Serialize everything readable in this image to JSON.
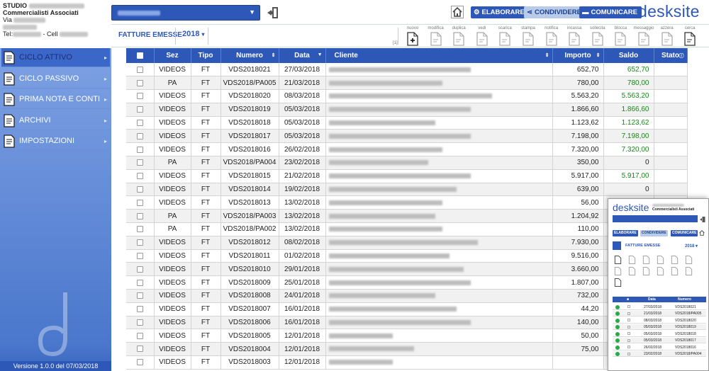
{
  "header": {
    "studio_line1": "STUDIO",
    "studio_line2": "Commercialisti Associati",
    "studio_line3": "Via",
    "studio_line5": "Tel:",
    "studio_cell": "- Cell",
    "company_select_value": "",
    "buttons": {
      "elaborare": "ELABORARE",
      "condividere": "CONDIVIDERE",
      "comunicare": "COMUNICARE"
    },
    "brand": "desksite"
  },
  "toolbar": {
    "title": "FATTURE EMESSE",
    "year": "2018",
    "year_caret": "▾",
    "marker": "[1]",
    "tools": [
      {
        "label": "nuovo",
        "icon": "new-doc-icon",
        "enabled": true
      },
      {
        "label": "modifica",
        "icon": "edit-doc-icon",
        "enabled": false
      },
      {
        "label": "duplica",
        "icon": "duplicate-doc-icon",
        "enabled": false
      },
      {
        "label": "vedi",
        "icon": "view-doc-icon",
        "enabled": false
      },
      {
        "label": "scarica",
        "icon": "download-doc-icon",
        "enabled": false
      },
      {
        "label": "stampa",
        "icon": "print-doc-icon",
        "enabled": false
      },
      {
        "label": "notifica",
        "icon": "notify-doc-icon",
        "enabled": false
      },
      {
        "label": "incassa",
        "icon": "collect-doc-icon",
        "enabled": false
      },
      {
        "label": "sollecita",
        "icon": "remind-doc-icon",
        "enabled": false
      },
      {
        "label": "blocca",
        "icon": "lock-doc-icon",
        "enabled": false
      },
      {
        "label": "messaggio",
        "icon": "message-doc-icon",
        "enabled": false
      },
      {
        "label": "azzera",
        "icon": "reset-doc-icon",
        "enabled": false
      },
      {
        "label": "cerca",
        "icon": "search-doc-icon",
        "enabled": true
      }
    ]
  },
  "sidebar": {
    "items": [
      {
        "label": "CICLO ATTIVO",
        "icon": "invoice-out-icon",
        "active": true
      },
      {
        "label": "CICLO PASSIVO",
        "icon": "invoice-in-icon",
        "active": false
      },
      {
        "label": "PRIMA NOTA E CONTI",
        "icon": "ledger-icon",
        "active": false
      },
      {
        "label": "ARCHIVI",
        "icon": "archive-icon",
        "active": false
      },
      {
        "label": "IMPOSTAZIONI",
        "icon": "settings-doc-icon",
        "active": false
      }
    ],
    "arrow": "▸",
    "footer": "Versione 1.0.0 del 07/03/2018"
  },
  "table": {
    "headers": {
      "sez": "Sez",
      "tipo": "Tipo",
      "numero": "Numero",
      "data": "Data",
      "cliente": "Cliente",
      "importo": "Importo",
      "saldo": "Saldo",
      "stato": "Stato"
    },
    "rows": [
      {
        "sez": "VIDEOS",
        "tipo": "FT",
        "numero": "VDS2018021",
        "data": "27/03/2018",
        "importo": "652,70",
        "saldo": "652,70",
        "green": true
      },
      {
        "sez": "PA",
        "tipo": "FT",
        "numero": "VDS2018/PA005",
        "data": "21/03/2018",
        "importo": "780,00",
        "saldo": "780,00",
        "green": true
      },
      {
        "sez": "VIDEOS",
        "tipo": "FT",
        "numero": "VDS2018020",
        "data": "08/03/2018",
        "importo": "5.563,20",
        "saldo": "5.563,20",
        "green": true
      },
      {
        "sez": "VIDEOS",
        "tipo": "FT",
        "numero": "VDS2018019",
        "data": "05/03/2018",
        "importo": "1.866,60",
        "saldo": "1.866,60",
        "green": true
      },
      {
        "sez": "VIDEOS",
        "tipo": "FT",
        "numero": "VDS2018018",
        "data": "05/03/2018",
        "importo": "1.123,62",
        "saldo": "1.123,62",
        "green": true
      },
      {
        "sez": "VIDEOS",
        "tipo": "FT",
        "numero": "VDS2018017",
        "data": "05/03/2018",
        "importo": "7.198,00",
        "saldo": "7.198,00",
        "green": true
      },
      {
        "sez": "VIDEOS",
        "tipo": "FT",
        "numero": "VDS2018016",
        "data": "26/02/2018",
        "importo": "7.320,00",
        "saldo": "7.320,00",
        "green": true
      },
      {
        "sez": "PA",
        "tipo": "FT",
        "numero": "VDS2018/PA004",
        "data": "23/02/2018",
        "importo": "350,00",
        "saldo": "0",
        "green": false
      },
      {
        "sez": "VIDEOS",
        "tipo": "FT",
        "numero": "VDS2018015",
        "data": "21/02/2018",
        "importo": "5.917,00",
        "saldo": "5.917,00",
        "green": true
      },
      {
        "sez": "VIDEOS",
        "tipo": "FT",
        "numero": "VDS2018014",
        "data": "19/02/2018",
        "importo": "639,00",
        "saldo": "0",
        "green": false
      },
      {
        "sez": "VIDEOS",
        "tipo": "FT",
        "numero": "VDS2018013",
        "data": "13/02/2018",
        "importo": "56,00",
        "saldo": "",
        "green": false
      },
      {
        "sez": "PA",
        "tipo": "FT",
        "numero": "VDS2018/PA003",
        "data": "13/02/2018",
        "importo": "1.204,92",
        "saldo": "",
        "green": false
      },
      {
        "sez": "PA",
        "tipo": "FT",
        "numero": "VDS2018/PA002",
        "data": "13/02/2018",
        "importo": "110,00",
        "saldo": "",
        "green": false
      },
      {
        "sez": "VIDEOS",
        "tipo": "FT",
        "numero": "VDS2018012",
        "data": "08/02/2018",
        "importo": "7.930,00",
        "saldo": "",
        "green": false
      },
      {
        "sez": "VIDEOS",
        "tipo": "FT",
        "numero": "VDS2018011",
        "data": "01/02/2018",
        "importo": "9.516,00",
        "saldo": "",
        "green": false
      },
      {
        "sez": "VIDEOS",
        "tipo": "FT",
        "numero": "VDS2018010",
        "data": "29/01/2018",
        "importo": "3.660,00",
        "saldo": "",
        "green": false
      },
      {
        "sez": "VIDEOS",
        "tipo": "FT",
        "numero": "VDS2018009",
        "data": "25/01/2018",
        "importo": "1.807,00",
        "saldo": "",
        "green": false
      },
      {
        "sez": "VIDEOS",
        "tipo": "FT",
        "numero": "VDS2018008",
        "data": "24/01/2018",
        "importo": "732,00",
        "saldo": "",
        "green": false
      },
      {
        "sez": "VIDEOS",
        "tipo": "FT",
        "numero": "VDS2018007",
        "data": "16/01/2018",
        "importo": "44,20",
        "saldo": "",
        "green": false
      },
      {
        "sez": "VIDEOS",
        "tipo": "FT",
        "numero": "VDS2018006",
        "data": "16/01/2018",
        "importo": "140,00",
        "saldo": "",
        "green": false
      },
      {
        "sez": "VIDEOS",
        "tipo": "FT",
        "numero": "VDS2018005",
        "data": "12/01/2018",
        "importo": "50,00",
        "saldo": "",
        "green": false
      },
      {
        "sez": "VIDEOS",
        "tipo": "FT",
        "numero": "VDS2018004",
        "data": "12/01/2018",
        "importo": "75,00",
        "saldo": "",
        "green": false
      },
      {
        "sez": "VIDEOS",
        "tipo": "FT",
        "numero": "VDS2018003",
        "data": "12/01/2018",
        "importo": "",
        "saldo": "",
        "green": false
      }
    ]
  },
  "mobile_preview": {
    "brand": "desksite",
    "studio": "Commercialisti Associati",
    "buttons": {
      "elaborare": "ELABORARE",
      "condividere": "CONDIVIDERE",
      "comunicare": "COMUNICARE"
    },
    "title": "FATTURE EMESSE",
    "year": "2018",
    "year_caret": "▾",
    "headers": {
      "data": "Data",
      "numero": "Numero"
    },
    "rows": [
      {
        "data": "27/03/2018",
        "numero": "VDS2018021"
      },
      {
        "data": "21/03/2018",
        "numero": "VDS2018/PA005"
      },
      {
        "data": "08/03/2018",
        "numero": "VDS2018020"
      },
      {
        "data": "05/03/2018",
        "numero": "VDS2018019"
      },
      {
        "data": "05/03/2018",
        "numero": "VDS2018018"
      },
      {
        "data": "05/03/2018",
        "numero": "VDS2018017"
      },
      {
        "data": "26/02/2018",
        "numero": "VDS2018016"
      },
      {
        "data": "23/02/2018",
        "numero": "VDS2018/PA004"
      }
    ]
  },
  "colors": {
    "primary": "#2e58b8",
    "sidebar": "#6f95de",
    "positive": "#138a13"
  }
}
